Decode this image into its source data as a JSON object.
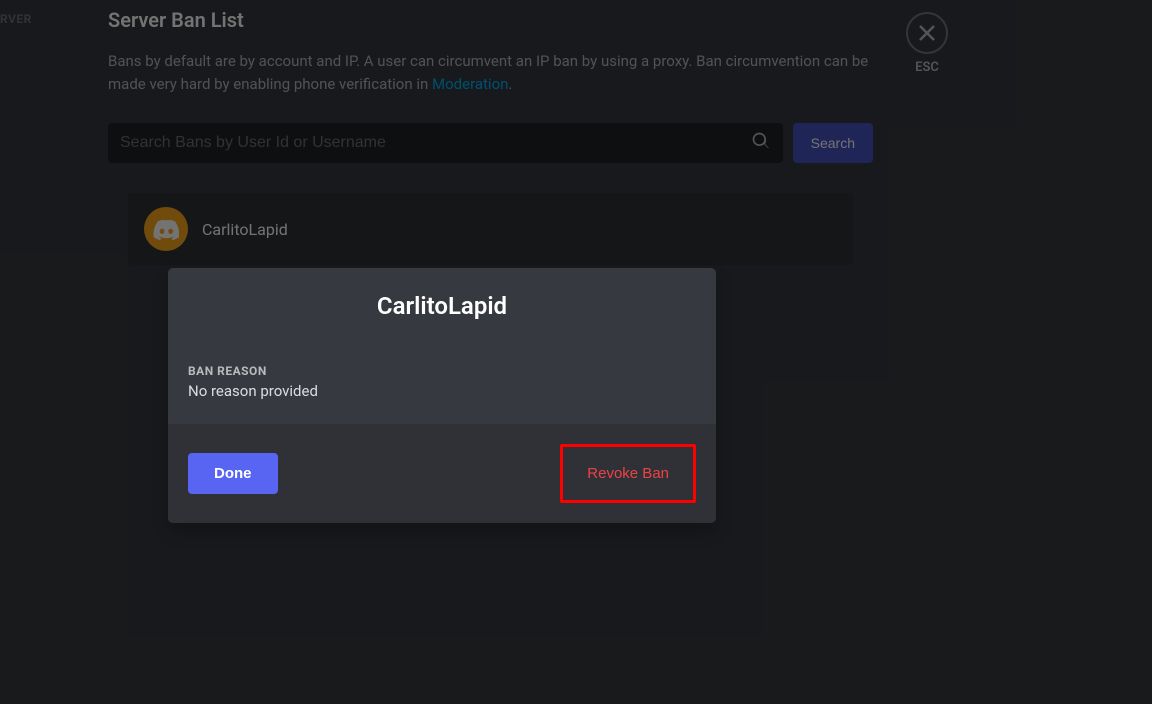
{
  "sidebar": {
    "partial_text": "RVER"
  },
  "header": {
    "title": "Server Ban List",
    "description_prefix": "Bans by default are by account and IP. A user can circumvent an IP ban by using a proxy. Ban circumvention can be made very hard by enabling phone verification in ",
    "moderation_link": "Moderation",
    "description_suffix": "."
  },
  "search": {
    "placeholder": "Search Bans by User Id or Username",
    "button_label": "Search"
  },
  "bans": [
    {
      "username": "CarlitoLapid"
    }
  ],
  "close": {
    "esc_label": "ESC"
  },
  "modal": {
    "username": "CarlitoLapid",
    "reason_label": "BAN REASON",
    "reason_value": "No reason provided",
    "done_label": "Done",
    "revoke_label": "Revoke Ban"
  }
}
